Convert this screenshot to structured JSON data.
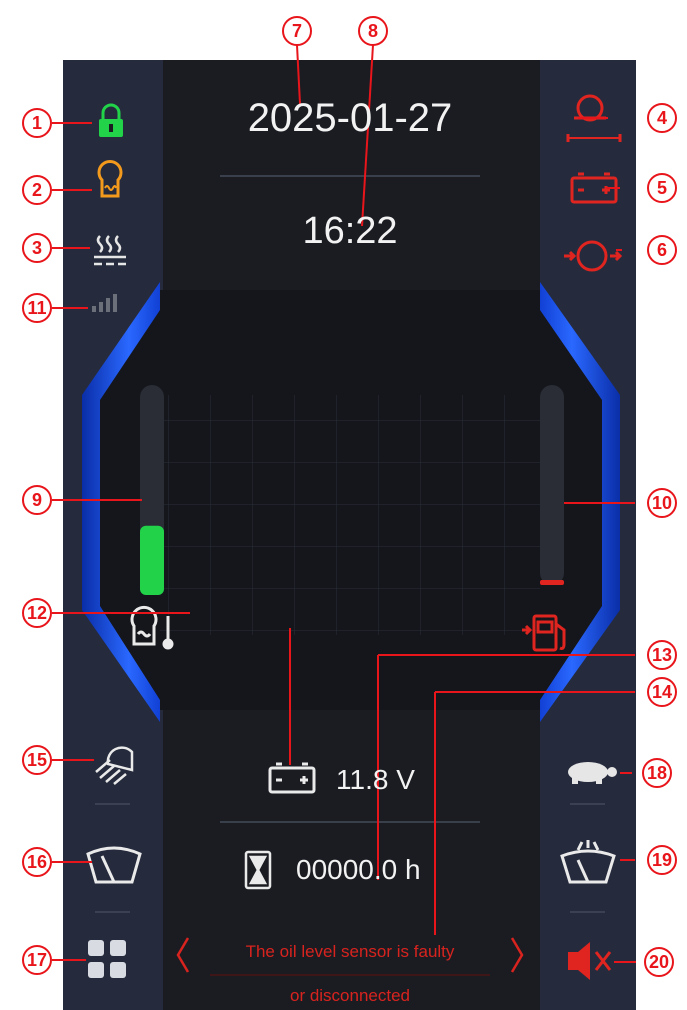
{
  "dashboard": {
    "date": "2025-01-27",
    "time": "16:22",
    "battery_voltage": "11.8 V",
    "engine_hours": "00000.0 h",
    "fault_message_line1": "The oil level sensor is faulty",
    "fault_message_line2": "or disconnected"
  },
  "gauges": {
    "coolant_temperature_fill": 0.33,
    "fuel_level_fill": 0.0
  },
  "callouts": [
    "1",
    "2",
    "3",
    "4",
    "5",
    "6",
    "7",
    "8",
    "9",
    "10",
    "11",
    "12",
    "13",
    "14",
    "15",
    "16",
    "17",
    "18",
    "19",
    "20"
  ],
  "icons": {
    "lock": "lock-icon",
    "engine_preheat": "glow-plug-icon",
    "heater": "heater-icon",
    "signal": "signal-bars-icon",
    "engine_fault": "engine-fault-icon",
    "battery_charge": "battery-charge-icon",
    "oil_pressure": "oil-pressure-icon",
    "coolant_temp": "coolant-temperature-icon",
    "fuel": "fuel-icon",
    "work_light": "work-light-icon",
    "wiper": "wiper-icon",
    "menu": "menu-grid-icon",
    "turtle": "turtle-speed-icon",
    "washer": "washer-icon",
    "mute": "mute-icon",
    "hourglass": "hourglass-icon"
  },
  "colors": {
    "panel": "#1a1c22",
    "bezel": "#252b3d",
    "accent_blue": "#1f5bff",
    "ok_green": "#22d34a",
    "warn_orange": "#f39a1d",
    "fault_red": "#e0241f",
    "callout_red": "#e8151b"
  }
}
